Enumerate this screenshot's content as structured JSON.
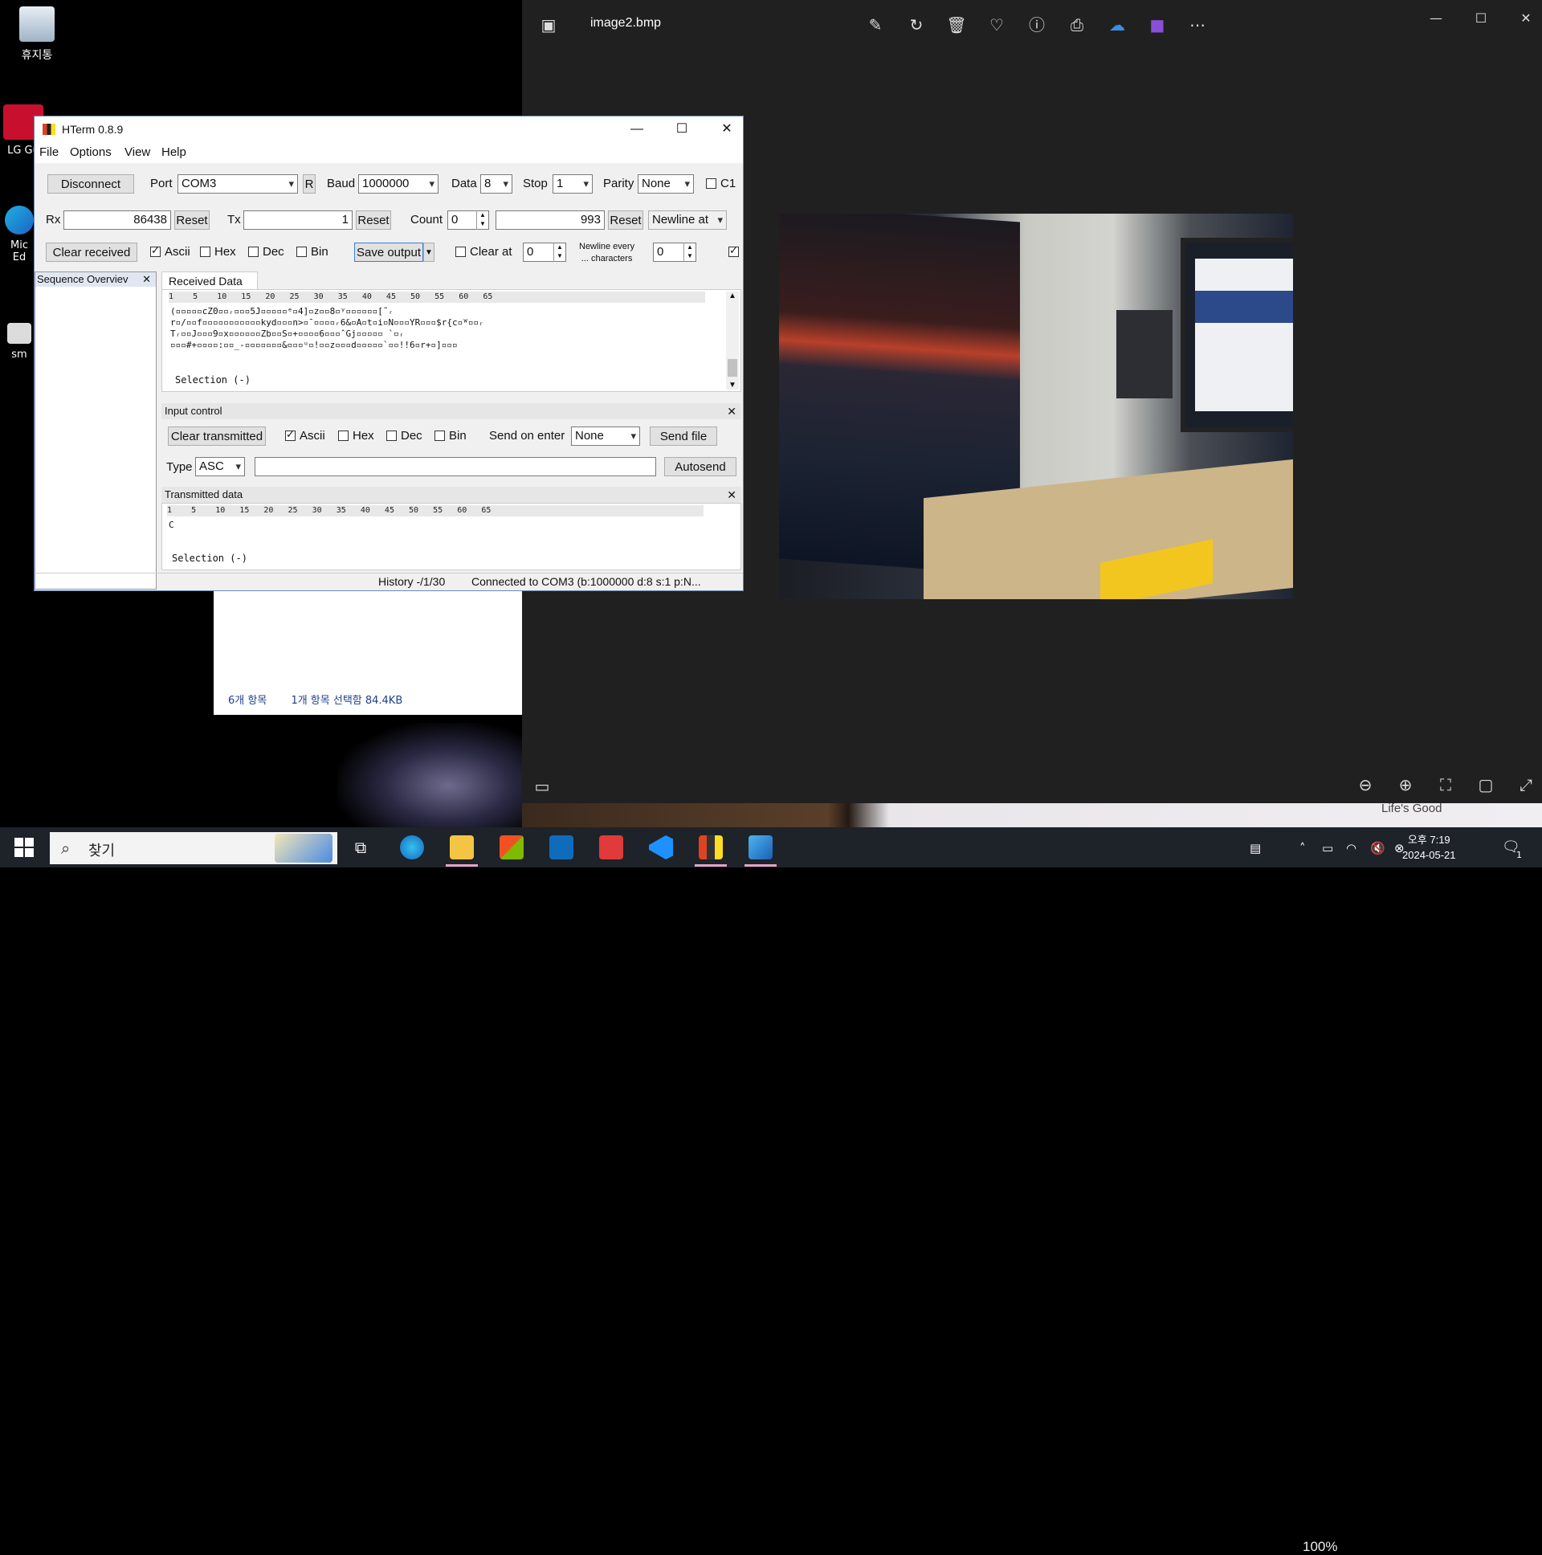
{
  "desktop": {
    "icons": [
      {
        "label": "휴지통"
      },
      {
        "label": "LG Gu"
      },
      {
        "label": "Mic Ed"
      },
      {
        "label": "sm"
      }
    ]
  },
  "explorer": {
    "status_items": "6개 항목",
    "status_selected": "1개 항목 선택함 84.4KB"
  },
  "photos": {
    "title": "image2.bmp",
    "zoom": "100%",
    "background_text": "Life's Good",
    "toolbar_icons": [
      "edit-icon",
      "rotate-icon",
      "delete-icon",
      "favorite-icon",
      "info-icon",
      "print-icon",
      "onedrive-icon",
      "clipchamp-icon",
      "more-icon"
    ]
  },
  "hterm": {
    "title": "HTerm 0.8.9",
    "menu": [
      "File",
      "Options",
      "View",
      "Help"
    ],
    "toolbar1": {
      "disconnect": "Disconnect",
      "port_label": "Port",
      "port_value": "COM3",
      "r_label": "R",
      "baud_label": "Baud",
      "baud_value": "1000000",
      "data_label": "Data",
      "data_value": "8",
      "stop_label": "Stop",
      "stop_value": "1",
      "parity_label": "Parity",
      "parity_value": "None",
      "c1_label": "C1"
    },
    "toolbar2": {
      "rx_label": "Rx",
      "rx_value": "86438",
      "reset1": "Reset",
      "tx_label": "Tx",
      "tx_value": "1",
      "reset2": "Reset",
      "count_label": "Count",
      "count_value": "0",
      "count_total": "993",
      "reset3": "Reset",
      "newline_at": "Newline at"
    },
    "toolbar3": {
      "clear_received": "Clear received",
      "ascii": "Ascii",
      "hex": "Hex",
      "dec": "Dec",
      "bin": "Bin",
      "save_output": "Save output",
      "clear_at": "Clear at",
      "clear_at_value": "0",
      "newline_every_1": "Newline every",
      "newline_every_2": "... characters",
      "newline_every_value": "0"
    },
    "sequence_overview": "Sequence Overviev",
    "received": {
      "tab": "Received Data",
      "ruler": "1    5    10   15   20   25   30   35   40   45   50   55   60   65",
      "lines": [
        "(▫▫▫▫▫cZ0▫▫ᵣ▫▫▫5J▫▫▫▫▫ᵉ▫4]▫z▫▫8▫ʸ▫▫▫▫▫▫[˜ᵣ",
        "r▫/▫▫f▫▫▫▫▫▫▫▫▫▫▫kyd▫▫▫n>▫¯▫▫▫▫ᵣ6&▫A▫t▫i▫N▫▫▫YR▫▫▫$r{c▫ᵂ▫▫ᵣ",
        "Tᵣ▫▫J▫▫▫9▫x▫▫▫▫▫▫Zb▫▫S▫+▫▫▫▫6▫▫▫ˆGj▫▫▫▫▫ `▫ᵣ",
        "▫▫▫#+▫▫▫▫:▫▫_-▫▫▫▫▫▫▫&▫▫▫ᵘ▫!▫▫z▫▫▫d▫▫▫▫▫`▫▫!!6▫r+▫]▫▫▫"
      ],
      "selection": "Selection (-)"
    },
    "input_control": {
      "title": "Input control",
      "clear_transmitted": "Clear transmitted",
      "ascii": "Ascii",
      "hex": "Hex",
      "dec": "Dec",
      "bin": "Bin",
      "send_on_enter": "Send on enter",
      "send_on_enter_value": "None",
      "send_file": "Send file",
      "type_label": "Type",
      "type_value": "ASC",
      "input_value": "",
      "autosend": "Autosend"
    },
    "transmitted": {
      "title": "Transmitted data",
      "ruler": "1    5    10   15   20   25   30   35   40   45   50   55   60   65",
      "line": "C",
      "selection": "Selection (-)"
    },
    "statusbar": {
      "history": "History -/1/30",
      "connection": "Connected to COM3 (b:1000000 d:8 s:1 p:N..."
    }
  },
  "taskbar": {
    "search_text": "찾기",
    "clock_time": "오후 7:19",
    "clock_date": "2024-05-21",
    "notification_count": "1"
  }
}
